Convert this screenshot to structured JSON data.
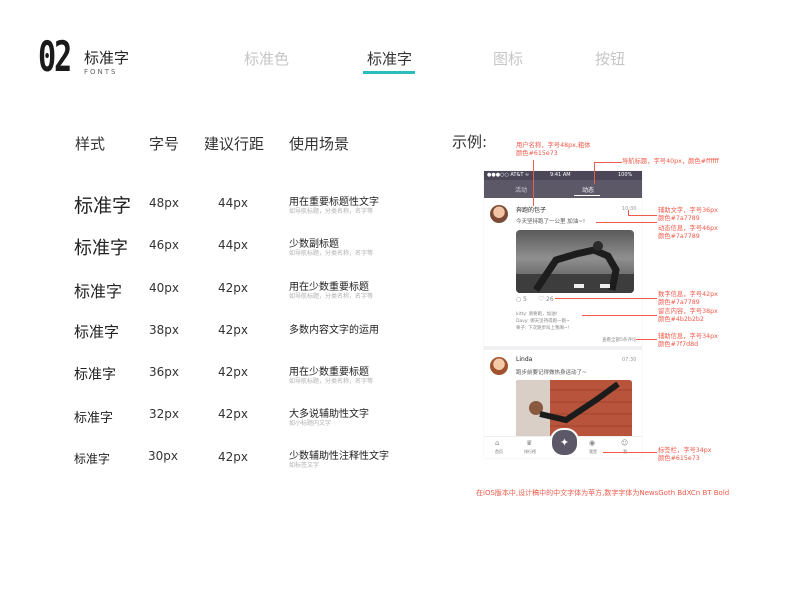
{
  "header": {
    "number": "02",
    "title": "标准字",
    "subtitle": "FONTS",
    "tabs": [
      "标准色",
      "标准字",
      "图标",
      "按钮"
    ],
    "active_tab": "标准字"
  },
  "table": {
    "columns": [
      "样式",
      "字号",
      "建议行距",
      "使用场景"
    ],
    "rows": [
      {
        "name": "标准字",
        "size": "48px",
        "line_height": "44px",
        "usage": "用在重要标题性文字",
        "hint": "如导航标题，分类名称，名字等"
      },
      {
        "name": "标准字",
        "size": "46px",
        "line_height": "44px",
        "usage": "少数副标题",
        "hint": "如导航标题，分类名称，名字等"
      },
      {
        "name": "标准字",
        "size": "40px",
        "line_height": "42px",
        "usage": "用在少数重要标题",
        "hint": "如导航标题，分类名称，名字等"
      },
      {
        "name": "标准字",
        "size": "38px",
        "line_height": "42px",
        "usage": "多数内容文字的运用",
        "hint": ""
      },
      {
        "name": "标准字",
        "size": "36px",
        "line_height": "42px",
        "usage": "用在少数重要标题",
        "hint": "如导航标题，分类名称，名字等"
      },
      {
        "name": "标准字",
        "size": "32px",
        "line_height": "42px",
        "usage": "大多说辅助性文字",
        "hint": "如小标题内文字"
      },
      {
        "name": "标准字",
        "size": "30px",
        "line_height": "42px",
        "usage": "少数辅助性注释性文字",
        "hint": "如标签文字"
      }
    ]
  },
  "example": {
    "label": "示例:",
    "phone": {
      "status_left": "●●●○○ AT&T ≈",
      "status_time": "9:41 AM",
      "status_right": "100%",
      "nav_tabs": [
        "活动",
        "动态"
      ],
      "post1": {
        "name": "奔跑的包子",
        "time": "10:30",
        "text": "今天坚持跑了一公里  加油~!",
        "likes_icon_count": "5",
        "hearts": "26",
        "comments": [
          {
            "user": "kitty:",
            "text": "真要跑，加油!"
          },
          {
            "user": "Davy:",
            "text": "哪天坚持得跑一跑~"
          },
          {
            "user": "栗子:",
            "text": "下次跑步叫上我啊~!"
          }
        ],
        "more": "查看全部5条评论"
      },
      "post2": {
        "name": "Linda",
        "time": "07:30",
        "text": "跑步前要记得做热身运动了~"
      },
      "bottom_tabs": [
        "首页",
        "排行榜",
        "",
        "我是",
        "我"
      ]
    },
    "annotations": [
      {
        "text": "用户名称，字号48px,粗体\n颜色#615e73"
      },
      {
        "text": "导航标题，字号40px，颜色#ffffff"
      },
      {
        "text": "辅助文字，字号36px\n颜色#7a7789"
      },
      {
        "text": "动态信息，字号46px\n颜色#7a7789"
      },
      {
        "text": "数字信息，字号42px\n颜色#7a7789"
      },
      {
        "text": "留言内容，字号38px\n颜色#4b2b2b2"
      },
      {
        "text": "辅助信息，字号34px\n颜色#7f7d8d"
      },
      {
        "text": "标签栏，字号34px\n颜色#615e73"
      }
    ],
    "footnote": "在iOS版本中,设计稿中的中文字体为苹方,数字字体为NewsGoth BdXCn BT Bold"
  },
  "colors": {
    "accent": "#2bbdbd",
    "annotation": "#f05a4a",
    "nav_bar": "#5c5868"
  }
}
